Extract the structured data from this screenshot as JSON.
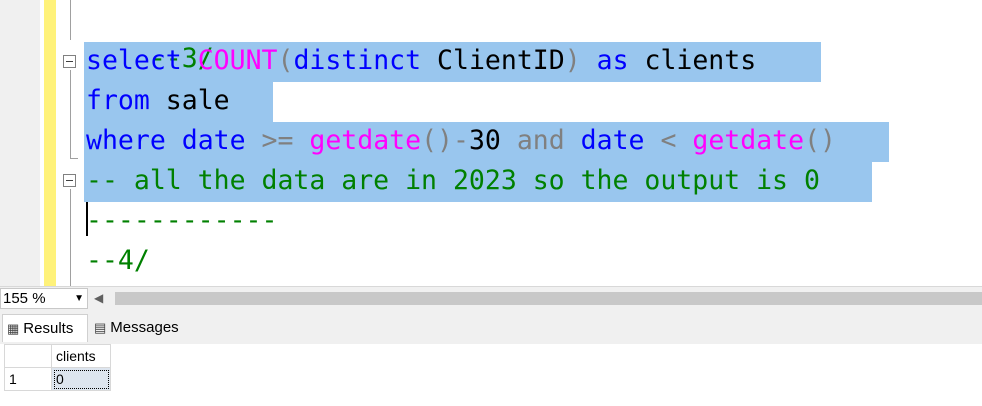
{
  "editor": {
    "lines": {
      "l1": {
        "comment": "--3/"
      },
      "l2": {
        "kw_select": "select",
        "fn_count": "COUNT",
        "paren_open": "(",
        "kw_distinct": "distinct",
        "id_clientid": " ClientID",
        "paren_close": ")",
        "kw_as": " as",
        "id_clients": " clients"
      },
      "l3": {
        "kw_from": "from",
        "id_sale": " sale"
      },
      "l4": {
        "kw_where": "where",
        "kw_date": " date",
        "op_gte": " >=",
        "fn_getdate": " getdate",
        "parens": "()",
        "op_minus": "-",
        "num": "30",
        "op_and": " and",
        "kw_date2": " date",
        "op_lt": " <",
        "fn_getdate2": " getdate",
        "parens2": "()"
      },
      "l5": {
        "comment": "-- all the data are in 2023 so the output is 0"
      },
      "l6": {
        "comment": "------------"
      },
      "l7": {
        "comment": "--4/"
      }
    }
  },
  "statusbar": {
    "zoom": "155 %"
  },
  "tabs": {
    "results": "Results",
    "messages": "Messages"
  },
  "results": {
    "columns": [
      "clients"
    ],
    "rows": [
      {
        "rownum": "1",
        "clients": "0"
      }
    ]
  },
  "colors": {
    "keyword": "#0000ff",
    "function": "#ff00ff",
    "operator": "#808080",
    "comment": "#008000",
    "selection": "#99c6ee",
    "margin": "#fff27a"
  }
}
